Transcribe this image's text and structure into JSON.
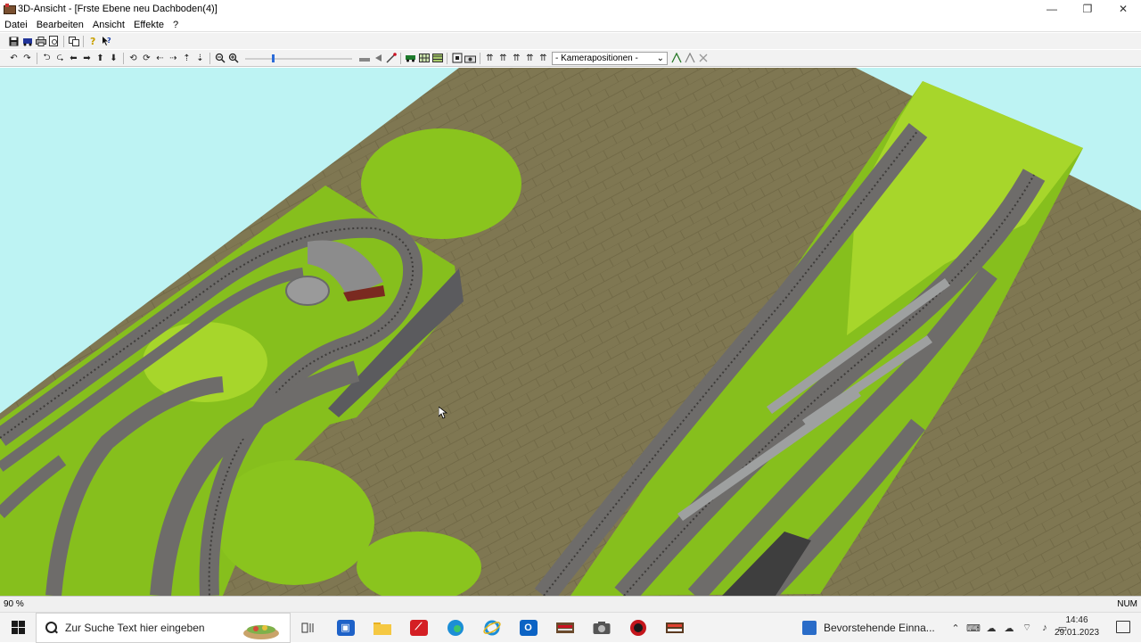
{
  "window": {
    "title": "3D-Ansicht - [Frste Ebene neu Dachboden(4)]",
    "controls": {
      "minimize": "—",
      "restore": "❐",
      "close": "✕"
    }
  },
  "menu": {
    "items": [
      "Datei",
      "Bearbeiten",
      "Ansicht",
      "Effekte",
      "?"
    ]
  },
  "toolbar": {
    "camera_select": "- Kamerapositionen -",
    "camera_dropdown_arrow": "⌄",
    "zoom_slider_value": 0.26
  },
  "status": {
    "zoom": "90 %",
    "num": "NUM"
  },
  "taskbar": {
    "search_placeholder": "Zur Suche Text hier eingeben",
    "notification_text": "Bevorstehende Einna...",
    "time": "14:46",
    "date": "29.01.2023"
  },
  "colors": {
    "sky": "#bdf3f3",
    "floor": "#7f7752",
    "grass": "#8ac41e",
    "track": "#6e6c6a",
    "accent": "#2a6bd8"
  }
}
